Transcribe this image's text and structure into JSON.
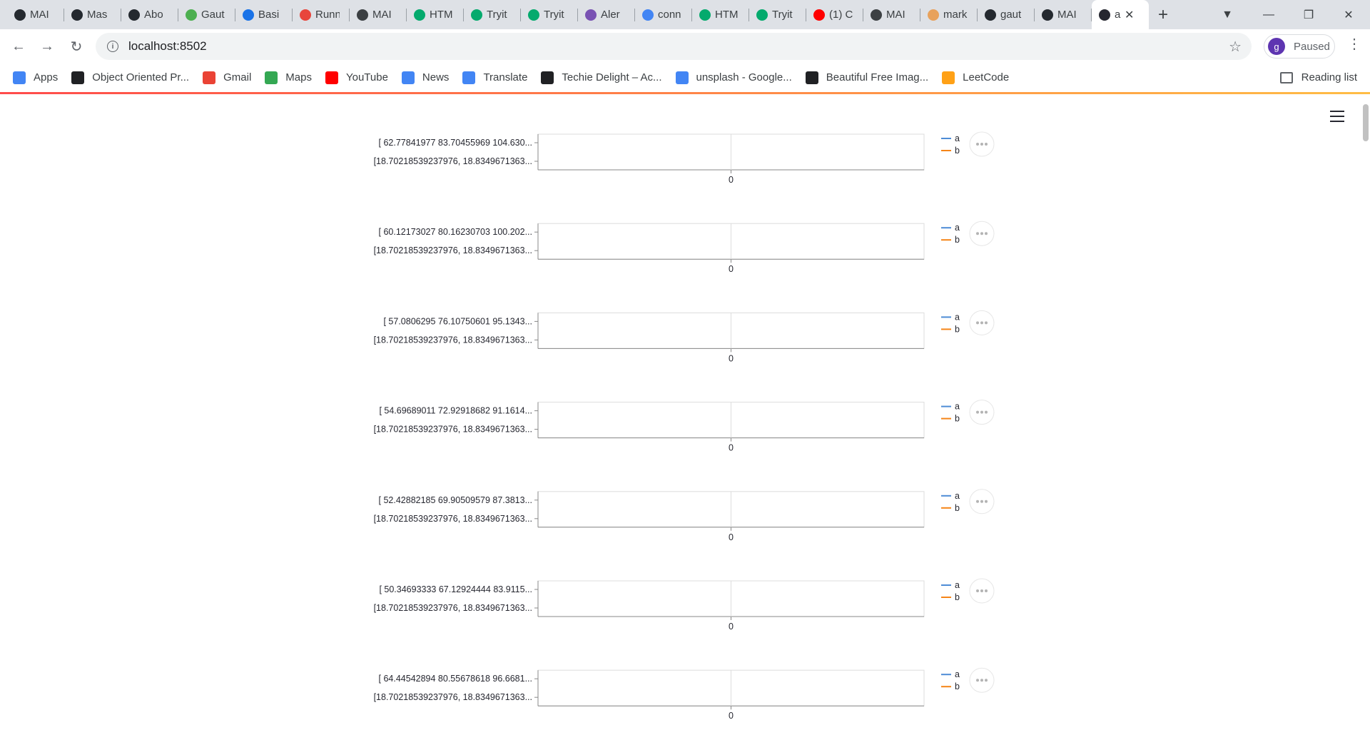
{
  "browser": {
    "tabs": [
      {
        "title": "MAI",
        "icon": "github-icon",
        "color": "#24292f"
      },
      {
        "title": "Mas",
        "icon": "github-icon",
        "color": "#24292f"
      },
      {
        "title": "Abo",
        "icon": "github-icon",
        "color": "#24292f"
      },
      {
        "title": "Gaut",
        "icon": "leaf-icon",
        "color": "#4caf50"
      },
      {
        "title": "Basi",
        "icon": "atlassian-icon",
        "color": "#1a73e8"
      },
      {
        "title": "Runn",
        "icon": "cloud-icon",
        "color": "#e8453c"
      },
      {
        "title": "MAI",
        "icon": "globe-icon",
        "color": "#3c4043"
      },
      {
        "title": "HTM",
        "icon": "w3schools-icon",
        "color": "#04aa6d"
      },
      {
        "title": "Tryit",
        "icon": "w3schools-icon",
        "color": "#04aa6d"
      },
      {
        "title": "Tryit",
        "icon": "w3schools-icon",
        "color": "#04aa6d"
      },
      {
        "title": "Aler",
        "icon": "bootstrap-icon",
        "color": "#7952b3"
      },
      {
        "title": "conn",
        "icon": "google-icon",
        "color": "#4285f4"
      },
      {
        "title": "HTM",
        "icon": "w3schools-icon",
        "color": "#04aa6d"
      },
      {
        "title": "Tryit",
        "icon": "w3schools-icon",
        "color": "#04aa6d"
      },
      {
        "title": "(1) C",
        "icon": "youtube-icon",
        "color": "#ff0000"
      },
      {
        "title": "MAI",
        "icon": "globe-icon",
        "color": "#3c4043"
      },
      {
        "title": "mark",
        "icon": "pen-icon",
        "color": "#e8a25c"
      },
      {
        "title": "gaut",
        "icon": "github-icon",
        "color": "#24292f"
      },
      {
        "title": "MAI",
        "icon": "github-icon",
        "color": "#24292f"
      },
      {
        "title": "a",
        "icon": "streamlit-icon",
        "color": "#262730",
        "active": true
      }
    ],
    "new_tab_label": "+",
    "url": "localhost:8502",
    "profile_initial": "g",
    "profile_status": "Paused",
    "bookmarks": [
      {
        "label": "Apps",
        "icon": "apps-grid-icon",
        "color": "#4285f4"
      },
      {
        "label": "Object Oriented Pr...",
        "icon": "code-icon",
        "color": "#202124"
      },
      {
        "label": "Gmail",
        "icon": "gmail-icon",
        "color": "#ea4335"
      },
      {
        "label": "Maps",
        "icon": "maps-pin-icon",
        "color": "#34a853"
      },
      {
        "label": "YouTube",
        "icon": "youtube-icon",
        "color": "#ff0000"
      },
      {
        "label": "News",
        "icon": "news-icon",
        "color": "#4285f4"
      },
      {
        "label": "Translate",
        "icon": "translate-icon",
        "color": "#4285f4"
      },
      {
        "label": "Techie Delight – Ac...",
        "icon": "td-icon",
        "color": "#202124"
      },
      {
        "label": "unsplash - Google...",
        "icon": "google-icon",
        "color": "#4285f4"
      },
      {
        "label": "Beautiful Free Imag...",
        "icon": "unsplash-icon",
        "color": "#202124"
      },
      {
        "label": "LeetCode",
        "icon": "leetcode-icon",
        "color": "#ffa116"
      }
    ],
    "reading_list_label": "Reading list"
  },
  "chart_data": [
    {
      "type": "line",
      "y_categories": [
        "[ 62.77841977  83.70455969 104.630...",
        "[18.70218539237976, 18.8349671363..."
      ],
      "x_ticks": [
        "0"
      ],
      "series": [
        {
          "name": "a",
          "color": "#4e8cd6"
        },
        {
          "name": "b",
          "color": "#f58518"
        }
      ]
    },
    {
      "type": "line",
      "y_categories": [
        "[ 60.12173027  80.16230703 100.202...",
        "[18.70218539237976, 18.8349671363..."
      ],
      "x_ticks": [
        "0"
      ],
      "series": [
        {
          "name": "a",
          "color": "#4e8cd6"
        },
        {
          "name": "b",
          "color": "#f58518"
        }
      ]
    },
    {
      "type": "line",
      "y_categories": [
        "[ 57.0806295   76.10750601  95.1343...",
        "[18.70218539237976, 18.8349671363..."
      ],
      "x_ticks": [
        "0"
      ],
      "series": [
        {
          "name": "a",
          "color": "#4e8cd6"
        },
        {
          "name": "b",
          "color": "#f58518"
        }
      ]
    },
    {
      "type": "line",
      "y_categories": [
        "[ 54.69689011  72.92918682  91.1614...",
        "[18.70218539237976, 18.8349671363..."
      ],
      "x_ticks": [
        "0"
      ],
      "series": [
        {
          "name": "a",
          "color": "#4e8cd6"
        },
        {
          "name": "b",
          "color": "#f58518"
        }
      ]
    },
    {
      "type": "line",
      "y_categories": [
        "[ 52.42882185  69.90509579  87.3813...",
        "[18.70218539237976, 18.8349671363..."
      ],
      "x_ticks": [
        "0"
      ],
      "series": [
        {
          "name": "a",
          "color": "#4e8cd6"
        },
        {
          "name": "b",
          "color": "#f58518"
        }
      ]
    },
    {
      "type": "line",
      "y_categories": [
        "[ 50.34693333  67.12924444  83.9115...",
        "[18.70218539237976, 18.8349671363..."
      ],
      "x_ticks": [
        "0"
      ],
      "series": [
        {
          "name": "a",
          "color": "#4e8cd6"
        },
        {
          "name": "b",
          "color": "#f58518"
        }
      ]
    },
    {
      "type": "line",
      "y_categories": [
        "[ 64.44542894  80.55678618  96.6681...",
        "[18.70218539237976, 18.8349671363..."
      ],
      "x_ticks": [
        "0"
      ],
      "series": [
        {
          "name": "a",
          "color": "#4e8cd6"
        },
        {
          "name": "b",
          "color": "#f58518"
        }
      ]
    }
  ]
}
